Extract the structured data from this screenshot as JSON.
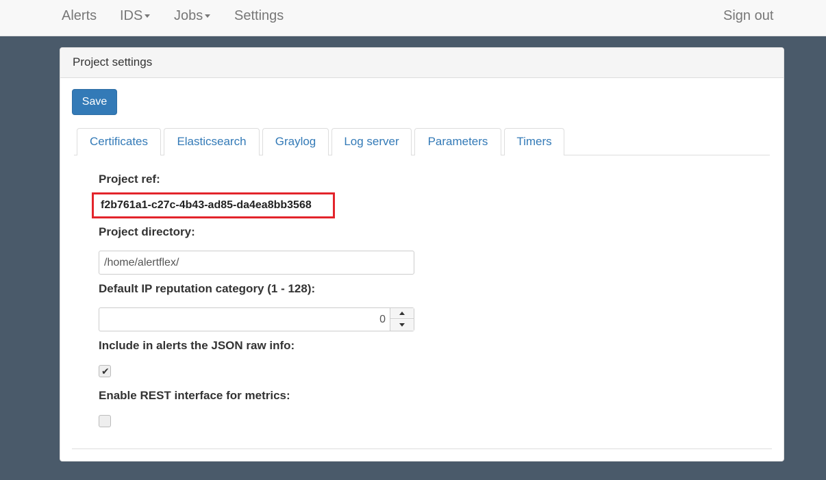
{
  "nav": {
    "alerts": "Alerts",
    "ids": "IDS",
    "jobs": "Jobs",
    "settings": "Settings",
    "sign_out": "Sign out"
  },
  "panel": {
    "title": "Project settings",
    "save_label": "Save"
  },
  "tabs": [
    {
      "label": "Certificates"
    },
    {
      "label": "Elasticsearch"
    },
    {
      "label": "Graylog"
    },
    {
      "label": "Log server"
    },
    {
      "label": "Parameters"
    },
    {
      "label": "Timers"
    }
  ],
  "active_tab": "Parameters",
  "form": {
    "project_ref_label": "Project ref:",
    "project_ref_value": "f2b761a1-c27c-4b43-ad85-da4ea8bb3568",
    "project_dir_label": "Project directory:",
    "project_dir_value": "/home/alertflex/",
    "ip_rep_label": "Default IP reputation category (1 - 128):",
    "ip_rep_value": "0",
    "json_raw_label": "Include in alerts the JSON raw info:",
    "json_raw_checked": true,
    "rest_label": "Enable REST interface for metrics:",
    "rest_checked": false
  },
  "colors": {
    "accent": "#337ab7",
    "highlight_border": "#e3242b",
    "background": "#4a5a6a"
  }
}
